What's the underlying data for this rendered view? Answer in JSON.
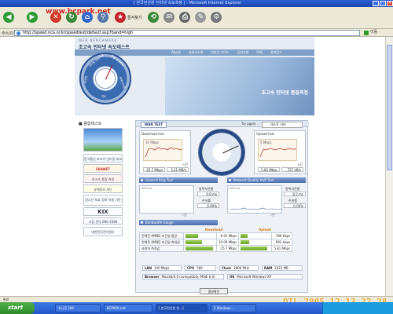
{
  "window": {
    "title": "[ 한국전산원 인터넷 속도측정 ] - Microsoft Internet Explorer"
  },
  "toolbar": {
    "brand_url": "www.bcpark.net",
    "favorites_label": "즐겨찾기"
  },
  "address": {
    "label": "주소(D)",
    "url": "http://speed.nca.or.kr/speedtest/default.asp?band=high",
    "go_label": "이동"
  },
  "header": {
    "subtitle": "WEB BENCHMARK",
    "title": "초고속 인터넷 속도테스트",
    "nav": [
      "About",
      "서비스소개",
      "인터넷 가이드",
      "공지사항",
      "FAQ",
      "줄겨찾기"
    ],
    "dial_labels": [
      "인터넷 속도측정",
      "망별 속도측정",
      "트래픽",
      "유해사이트",
      "지도"
    ],
    "banner_text": "초고속 인터넷 품질측정"
  },
  "left_menu": {
    "title": "종합테스트",
    "items": [
      "",
      "한국통신 초고속 인터넷 비교정보",
      "EKANET",
      "초고속 품질 측정",
      "유해정보 차단",
      "청소년 보호 정보 이용 기준 서비스",
      "KIX",
      "고장 문의 080-1588",
      "대한민국전자정부"
    ]
  },
  "panel": {
    "tab": "WAN TEST",
    "try_again": "Try again",
    "test_server_label": "테스트 서버",
    "download": {
      "label": "Download test",
      "axis": "35 Mbps",
      "speed": "25.7 Mbps",
      "bytes": "3.21 MB/s",
      "unit": "시간"
    },
    "upload": {
      "label": "Upload test",
      "axis": "5 Mbps",
      "speed": "5.81 Mbps",
      "bytes": "727 kB/s",
      "unit": "시간"
    },
    "ping_section": "General Ping Test",
    "voip_section": "Network Quality VoIP Test",
    "ping": {
      "axis": "200 ms",
      "jitter_label": "왕복지연율",
      "jitter_value": "0.0 ms",
      "loss_label": "손실률",
      "loss_value": "0.00%",
      "xlabel": "시간"
    },
    "voip": {
      "axis": "200 ms",
      "jitter_label": "왕복지연율",
      "jitter_value": "8.2 ms",
      "loss_label": "손실률",
      "loss_value": "0.00%",
      "xlabel": "시간"
    },
    "bandwidth_section": "Bandwidth Gauge",
    "bw_headers": {
      "download": "Download",
      "upload": "Upload"
    },
    "bw_rows": [
      {
        "label": "전체된 XMBD 조건일 평균",
        "down": "6.91 Mbps",
        "down_pct": 0.42,
        "up": "786 kbps",
        "up_pct": 0.24
      },
      {
        "label": "전체된 XMBD 조건일 최대값",
        "down": "10.00 Mbps",
        "down_pct": 0.58,
        "up": "992 kbps",
        "up_pct": 0.3
      },
      {
        "label": "사용자 측정값",
        "down": "25.7 Mbps",
        "down_pct": 0.95,
        "up": "5.81 Mbps",
        "up_pct": 0.9
      }
    ],
    "sys": {
      "lan_k": "LAN",
      "lan_v": "100 Mbps",
      "cpu_k": "CPU",
      "cpu_v": "586",
      "clock_k": "Clock",
      "clock_v": "2806 MHz",
      "ram_k": "RAM",
      "ram_v": "1023 MB",
      "browser_k": "Browser",
      "browser_v": "Mozilla/4.0 (compatible; MSIE 6.0)",
      "os_k": "OS",
      "os_v": "Microsoft Windows XP"
    },
    "result_button": "결과확인"
  },
  "status": {
    "text": "완료"
  },
  "taskbar": {
    "start": "start",
    "items": [
      "유니콘 286",
      "BCPARK.net",
      "[ 한국전산원 인...]",
      "2 Windows..."
    ]
  },
  "photo_timestamp": "DIL 2005 12 13 22 28 16",
  "colors": {
    "titlebar": "#1c43a8",
    "accent_blue": "#4c6fae",
    "bar_green": "#6aa52b",
    "timestamp": "#e8a83a"
  }
}
